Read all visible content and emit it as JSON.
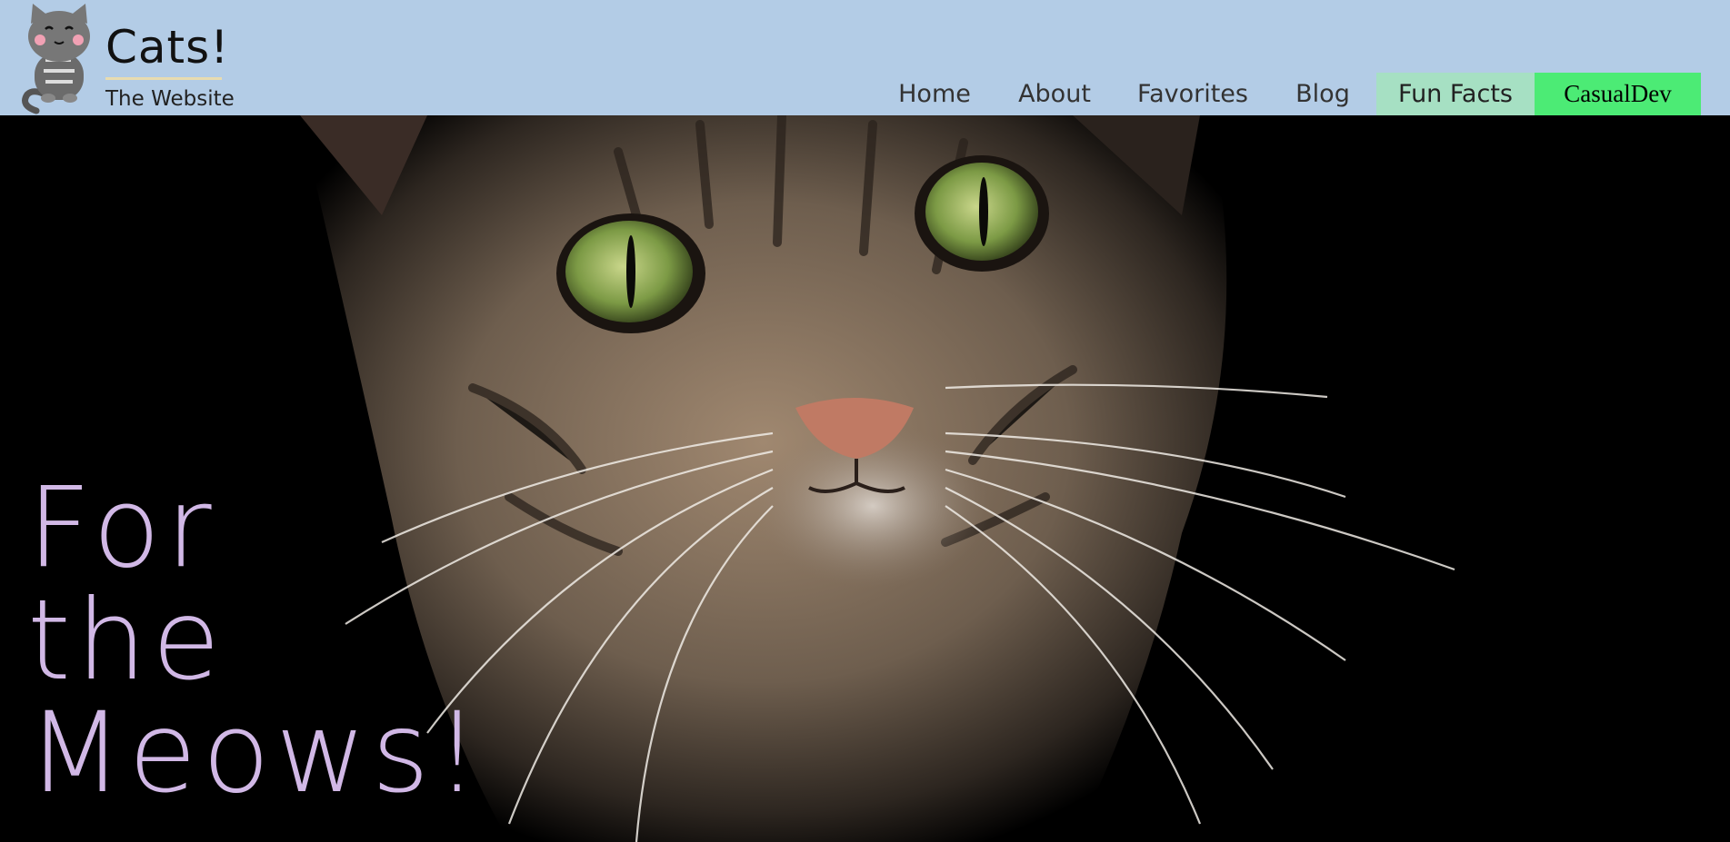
{
  "header": {
    "logo_title": "Cats!",
    "logo_subtitle": "The Website",
    "nav": [
      {
        "label": "Home",
        "active": false
      },
      {
        "label": "About",
        "active": false
      },
      {
        "label": "Favorites",
        "active": false
      },
      {
        "label": "Blog",
        "active": false
      },
      {
        "label": "Fun Facts",
        "active": true
      }
    ],
    "cta_label": "CasualDev"
  },
  "hero": {
    "headline_lines": [
      "For",
      "the",
      "Meows!"
    ]
  },
  "colors": {
    "header_bg": "#b3cce6",
    "active_tab": "#a6e0c3",
    "cta_bg": "#4ceb75",
    "headline": "#d1b8e6"
  }
}
